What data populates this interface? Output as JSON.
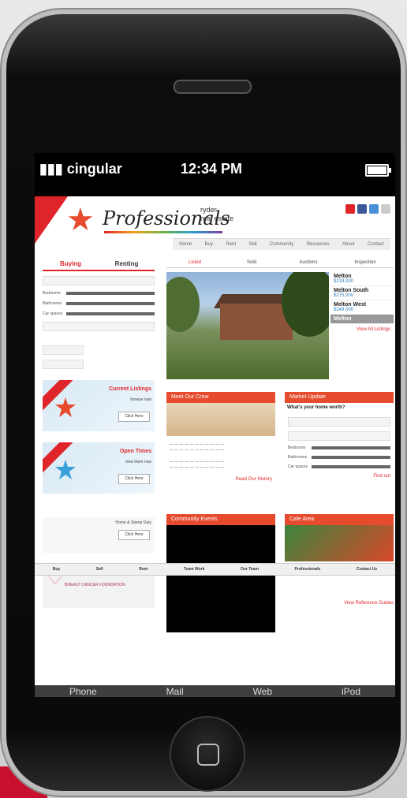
{
  "statusbar": {
    "carrier": "cingular",
    "time": "12:34 PM"
  },
  "site": {
    "logo": "Professionals",
    "agency": [
      "ryder",
      "real estate"
    ],
    "nav": [
      "Home",
      "Buy",
      "Rent",
      "Sell",
      "Community",
      "Resources",
      "About",
      "Contact"
    ]
  },
  "left": {
    "tabs": [
      "Buying",
      "Renting"
    ],
    "sliders": [
      "Bedrooms",
      "Bathrooms",
      "Car spaces"
    ],
    "promos": [
      {
        "title": "Current Listings",
        "sub": "browse now",
        "button": "Click Here"
      },
      {
        "title": "Open Times",
        "sub": "view them now",
        "button": "Click Here"
      },
      {
        "title": "",
        "sub": "Home & Stamp Duty",
        "button": "Click Here"
      }
    ],
    "pink_banner": "BREAST CANCER FOUNDATION"
  },
  "main": {
    "tabs": [
      "Listed",
      "Sold",
      "Auctions",
      "Inspection"
    ],
    "listings": [
      {
        "name": "Melton",
        "price": "$219,000"
      },
      {
        "name": "Melton South",
        "price": "$275,000"
      },
      {
        "name": "Melton West",
        "price": "$249,000"
      },
      {
        "name": "Melton",
        "price": ""
      }
    ],
    "view_all": "View All Listings",
    "box1_header": "Meet Our Crew",
    "box1_link": "Read Our History",
    "box2_header": "Market Update",
    "box2_title": "What's your home worth?",
    "box2_link": "Find out",
    "box3_header": "Community Events",
    "box4_header": "Cafe Area",
    "box4_link": "View Reference Guides"
  },
  "bottom_nav": [
    "Buy",
    "Sell",
    "Rent",
    "Team Work",
    "Our Team",
    "Professionals",
    "Contact Us"
  ],
  "dock": [
    "Phone",
    "Mail",
    "Web",
    "iPod"
  ],
  "colors": {
    "accent": "#e0252a",
    "link": "#2a7fbf"
  }
}
